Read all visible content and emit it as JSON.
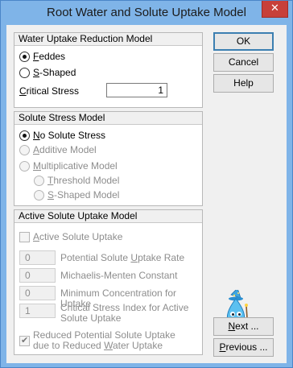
{
  "window": {
    "title": "Root Water and Solute Uptake Model",
    "close_glyph": "✕"
  },
  "water_uptake": {
    "header": "Water Uptake Reduction Model",
    "option_feddes": {
      "prefix": "",
      "accel": "F",
      "rest": "eddes"
    },
    "option_sshaped": {
      "prefix": "",
      "accel": "S",
      "rest": "-Shaped"
    },
    "selected": "feddes",
    "critical_stress": {
      "prefix": "",
      "accel": "C",
      "rest": "ritical Stress",
      "value": "1"
    }
  },
  "solute_stress": {
    "header": "Solute Stress Model",
    "option_none": {
      "prefix": "",
      "accel": "N",
      "rest": "o Solute Stress"
    },
    "option_additive": {
      "prefix": "",
      "accel": "A",
      "rest": "dditive Model"
    },
    "option_multiplicative": {
      "prefix": "",
      "accel": "M",
      "rest": "ultiplicative Model"
    },
    "option_threshold": {
      "prefix": "",
      "accel": "T",
      "rest": "hreshold Model"
    },
    "option_sshaped": {
      "prefix": "",
      "accel": "S",
      "rest": "-Shaped Model"
    },
    "selected": "none"
  },
  "active_uptake": {
    "header": "Active Solute Uptake Model",
    "checkbox": {
      "prefix": "",
      "accel": "A",
      "rest": "ctive Solute Uptake",
      "checked": false
    },
    "params": [
      {
        "value": "0",
        "label_prefix": "Potential Solute ",
        "accel": "U",
        "label_rest": "ptake Rate"
      },
      {
        "value": "0",
        "label_prefix": "Michaelis-Menten Constant",
        "accel": "",
        "label_rest": ""
      },
      {
        "value": "0",
        "label_prefix": "Minimum Concentration for Uptake",
        "accel": "",
        "label_rest": ""
      },
      {
        "value": "1",
        "label_line1": "Critical Stress Index for Active",
        "label_line2": "Solute Uptake"
      }
    ],
    "reduced": {
      "line1": "Reduced Potential Solute Uptake",
      "line2_prefix": "due to Reduced ",
      "line2_accel": "W",
      "line2_rest": "ater Uptake",
      "checked": true
    }
  },
  "buttons": {
    "ok": "OK",
    "cancel": "Cancel",
    "help": "Help",
    "next": {
      "accel": "N",
      "rest": "ext ..."
    },
    "previous": {
      "accel": "P",
      "rest": "revious ..."
    }
  },
  "colors": {
    "frame": "#7fb4e8",
    "close": "#c7403a",
    "default_button_border": "#3c7fb1"
  },
  "icons": {
    "mascot": "water-drop-wizard-icon"
  }
}
